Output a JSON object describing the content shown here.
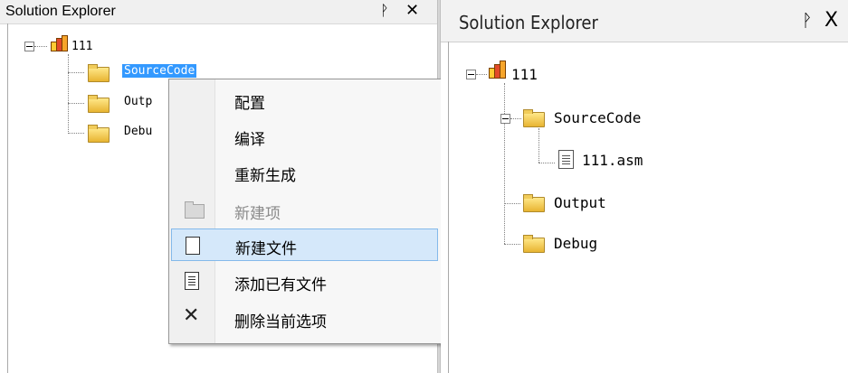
{
  "left_panel": {
    "title": "Solution Explorer",
    "pin_glyph": "ᚹ",
    "close_glyph": "✕",
    "tree": {
      "project": "111",
      "folders": [
        {
          "label": "SourceCode",
          "visible_text": "SourceCode",
          "selected": true
        },
        {
          "label": "Output",
          "visible_text": "Outp"
        },
        {
          "label": "Debug",
          "visible_text": "Debu"
        }
      ]
    }
  },
  "context_menu": {
    "items": [
      {
        "label": "配置",
        "enabled": true
      },
      {
        "label": "编译",
        "enabled": true
      },
      {
        "label": "重新生成",
        "enabled": true
      },
      {
        "label": "新建项",
        "enabled": false,
        "icon": "folder-icon"
      },
      {
        "label": "新建文件",
        "enabled": true,
        "icon": "new-file-icon",
        "hovered": true
      },
      {
        "label": "添加已有文件",
        "enabled": true,
        "icon": "file-icon"
      },
      {
        "label": "删除当前选项",
        "enabled": true,
        "icon": "delete-icon"
      }
    ],
    "delete_glyph": "✕"
  },
  "right_panel": {
    "title": "Solution Explorer",
    "pin_glyph": "ᚹ",
    "close_glyph": "X",
    "tree": {
      "project": "111",
      "folders": [
        {
          "label": "SourceCode",
          "children": [
            "111.asm"
          ]
        },
        {
          "label": "Output"
        },
        {
          "label": "Debug"
        }
      ]
    }
  },
  "colors": {
    "selection": "#3399ff",
    "menu_hover_bg": "#d5e8fa",
    "menu_hover_border": "#84b9ea",
    "disabled_text": "#8a8a8a"
  }
}
